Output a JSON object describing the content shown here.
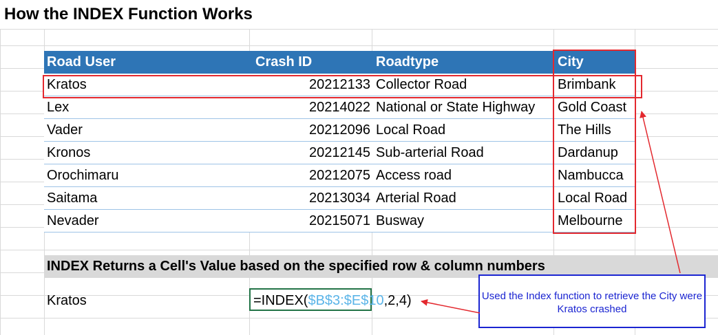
{
  "title": "How the INDEX Function Works",
  "table": {
    "headers": [
      "Road User",
      "Crash ID",
      "Roadtype",
      "City"
    ],
    "rows": [
      [
        "Kratos",
        "20212133",
        "Collector Road",
        "Brimbank"
      ],
      [
        "Lex",
        "20214022",
        "National or State Highway",
        "Gold Coast"
      ],
      [
        "Vader",
        "20212096",
        "Local Road",
        "The Hills"
      ],
      [
        "Kronos",
        "20212145",
        "Sub-arterial Road",
        "Dardanup"
      ],
      [
        "Orochimaru",
        "20212075",
        "Access road",
        "Nambucca"
      ],
      [
        "Saitama",
        "20213034",
        "Arterial Road",
        "Local Road"
      ],
      [
        "Nevader",
        "20215071",
        "Busway",
        "Melbourne"
      ]
    ]
  },
  "note": "INDEX Returns a Cell's Value based on the specified row & column numbers",
  "result": {
    "label": "Kratos",
    "formula_prefix": "=INDEX(",
    "formula_ref": "$B$3:$E$10",
    "formula_suffix": ",2,4)"
  },
  "callout": "Used the Index function to retrieve the City were Kratos crashed",
  "colors": {
    "header_fill": "#2e75b6",
    "highlight_border": "#e3282e",
    "callout_border": "#1a24d1",
    "active_cell_border": "#217346",
    "range_ref": "#5ab4e8"
  }
}
